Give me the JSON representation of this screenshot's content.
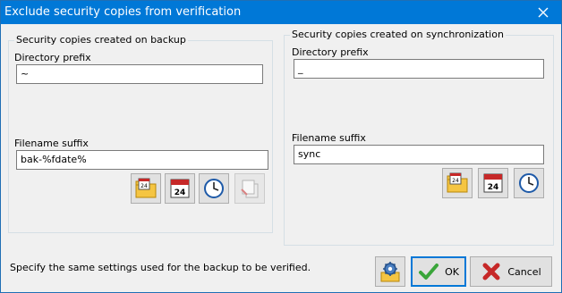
{
  "window": {
    "title": "Exclude security copies from verification"
  },
  "backup_group": {
    "title": "Security copies created on backup",
    "directory_prefix_label": "Directory prefix",
    "directory_prefix_value": "~",
    "filename_suffix_label": "Filename suffix",
    "filename_suffix_value": "bak-%fdate%"
  },
  "sync_group": {
    "title": "Security copies created on synchronization",
    "directory_prefix_label": "Directory prefix",
    "directory_prefix_value": "_",
    "filename_suffix_label": "Filename suffix",
    "filename_suffix_value": "sync"
  },
  "buttons": {
    "ok": "OK",
    "cancel": "Cancel"
  },
  "footer": {
    "hint": "Specify the same settings used for the backup to be verified."
  },
  "calendar_day": "24",
  "colors": {
    "titlebar": "#0078d7",
    "accent_red": "#c62828",
    "ok_green": "#3aa53a"
  }
}
